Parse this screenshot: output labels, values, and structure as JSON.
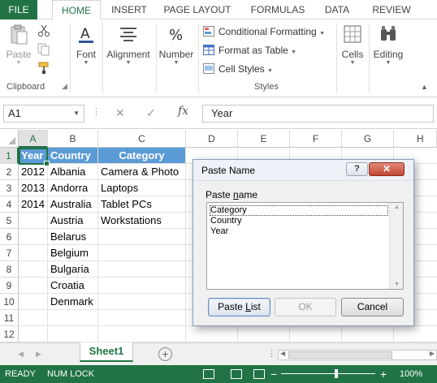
{
  "ribbon_tabs": [
    "FILE",
    "HOME",
    "INSERT",
    "PAGE LAYOUT",
    "FORMULAS",
    "DATA",
    "REVIEW"
  ],
  "ribbon": {
    "clipboard": {
      "paste_label": "Paste",
      "group_label": "Clipboard"
    },
    "font_label": "Font",
    "alignment_label": "Alignment",
    "number_label": "Number",
    "styles": {
      "conditional_formatting": "Conditional Formatting",
      "format_as_table": "Format as Table",
      "cell_styles": "Cell Styles",
      "group_label": "Styles"
    },
    "cells_label": "Cells",
    "editing_label": "Editing"
  },
  "formula_bar": {
    "name_box": "A1",
    "fx": "fx",
    "value": "Year"
  },
  "grid": {
    "columns": [
      "A",
      "B",
      "C",
      "D",
      "E",
      "F",
      "G",
      "H"
    ],
    "rows": [
      "1",
      "2",
      "3",
      "4",
      "5",
      "6",
      "7",
      "8",
      "9",
      "10",
      "11",
      "12"
    ],
    "headers": {
      "A": "Year",
      "B": "Country",
      "C": "Category"
    },
    "year": [
      "2012",
      "2013",
      "2014"
    ],
    "country": [
      "Albania",
      "Andorra",
      "Australia",
      "Austria",
      "Belarus",
      "Belgium",
      "Bulgaria",
      "Croatia",
      "Denmark"
    ],
    "category": [
      "Camera & Photo",
      "Laptops",
      "Tablet PCs",
      "Workstations"
    ]
  },
  "sheets": {
    "active": "Sheet1",
    "add_symbol": "+"
  },
  "status": {
    "ready": "READY",
    "numlock": "NUM LOCK",
    "zoom": "100%"
  },
  "dialog": {
    "title": "Paste Name",
    "help": "?",
    "close": "✕",
    "list_label_pre": "Paste ",
    "list_label_ul": "n",
    "list_label_post": "ame",
    "names": [
      "Category",
      "Country",
      "Year"
    ],
    "paste_list_pre": "Paste ",
    "paste_list_ul": "L",
    "paste_list_post": "ist",
    "ok": "OK",
    "cancel": "Cancel"
  },
  "colors": {
    "excel_green": "#217346",
    "table_header": "#5b9bd5",
    "dialog_close": "#c24632"
  }
}
